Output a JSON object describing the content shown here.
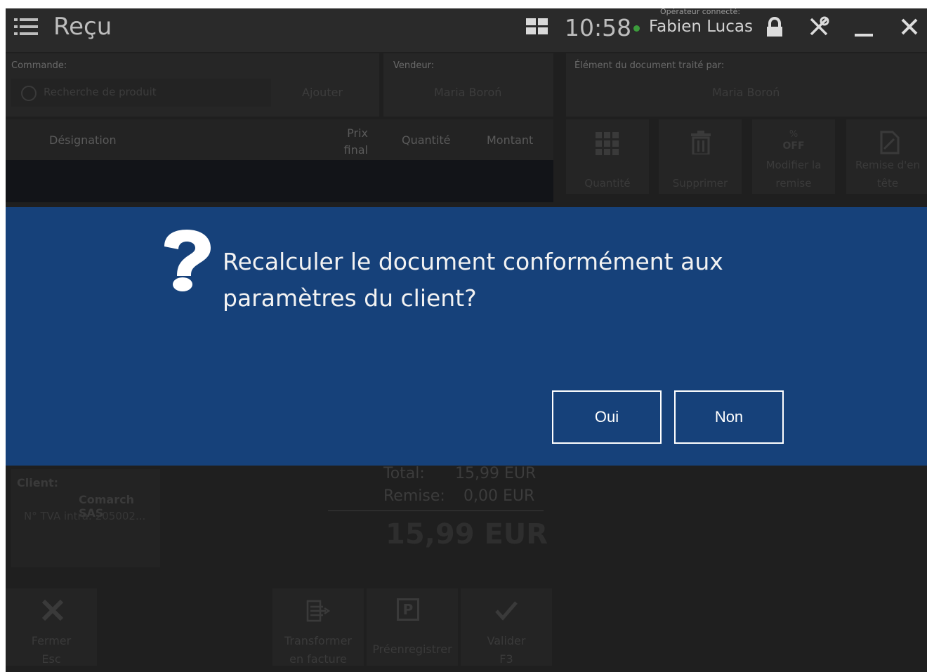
{
  "header": {
    "title": "Reçu",
    "time": "10:58",
    "operator_caption": "Opérateur connecté:",
    "operator_name": "Fabien Lucas"
  },
  "order": {
    "label": "Commande:",
    "search_placeholder": "Recherche de produit",
    "add_label": "Ajouter",
    "seller_label": "Vendeur:",
    "seller_value": "Maria Boroń"
  },
  "processed_by": {
    "label": "Élément du document traité par:",
    "value": "Maria Boroń"
  },
  "table": {
    "columns": [
      "Désignation",
      "Prix final",
      "Quantité",
      "Montant"
    ]
  },
  "actions": {
    "quantity": "Quantité",
    "delete": "Supprimer",
    "edit_discount": "Modifier la remise",
    "header_discount": "Remise d'en tête",
    "off_badge": "OFF"
  },
  "client": {
    "label": "Client:",
    "name": "Comarch SAS",
    "vat": "N° TVA intra: 205002..."
  },
  "totals": {
    "total_label": "Total:",
    "total_value": "15,99 EUR",
    "discount_label": "Remise:",
    "discount_value": "0,00 EUR",
    "grand_total": "15,99 EUR"
  },
  "bottom_buttons": {
    "close": "Fermer",
    "close_key": "Esc",
    "to_invoice": "Transformer en facture",
    "preregister": "Préenregistrer",
    "validate": "Valider",
    "validate_key": "F3"
  },
  "dialog": {
    "message_line1": "Recalculer le document conformément aux",
    "message_line2": "paramètres du client?",
    "yes": "Oui",
    "no": "Non"
  },
  "colors": {
    "dialog_bg": "#16417a",
    "status_dot": "#3c9c3c"
  }
}
